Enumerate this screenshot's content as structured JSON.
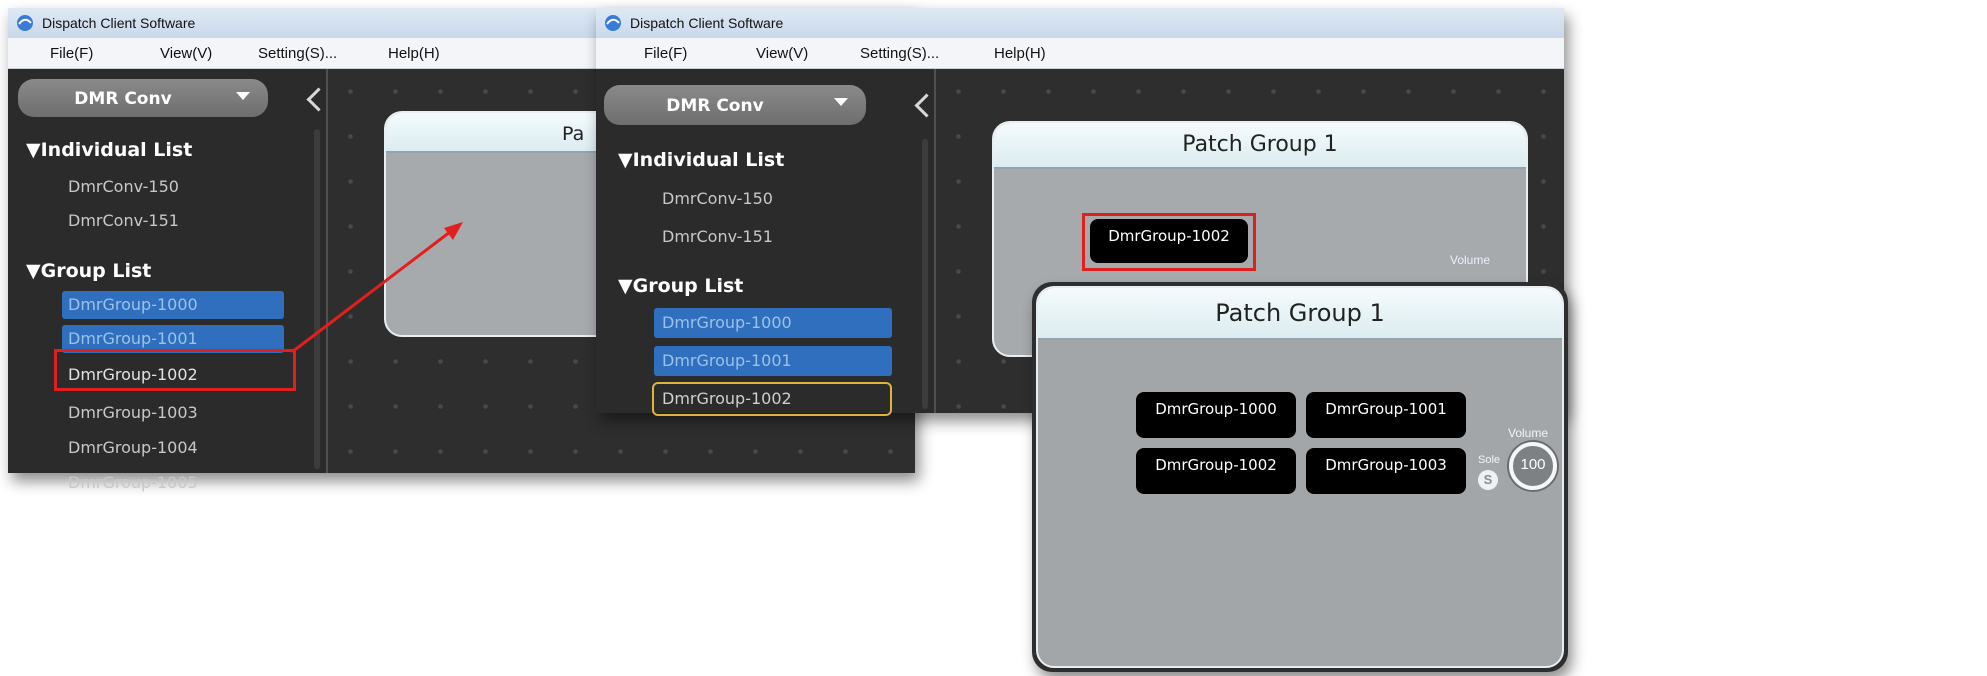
{
  "window1": {
    "title": "Dispatch Client Software",
    "menu": [
      "File(F)",
      "View(V)",
      "Setting(S)...",
      "Help(H)"
    ],
    "combo": "DMR Conv",
    "individual_header": "▼Individual List",
    "individual_items": [
      "DmrConv-150",
      "DmrConv-151"
    ],
    "group_header": "▼Group List",
    "group_items": [
      "DmrGroup-1000",
      "DmrGroup-1001",
      "DmrGroup-1002",
      "DmrGroup-1003",
      "DmrGroup-1004",
      "DmrGroup-1005"
    ],
    "panel_title_fragment": "Pa"
  },
  "window2": {
    "title": "Dispatch Client Software",
    "menu": [
      "File(F)",
      "View(V)",
      "Setting(S)...",
      "Help(H)"
    ],
    "combo": "DMR Conv",
    "individual_header": "▼Individual List",
    "individual_items": [
      "DmrConv-150",
      "DmrConv-151"
    ],
    "group_header": "▼Group List",
    "group_items": [
      "DmrGroup-1000",
      "DmrGroup-1001",
      "DmrGroup-1002"
    ],
    "panel_title": "Patch Group 1",
    "chip": "DmrGroup-1002",
    "volume_label": "Volume"
  },
  "panel3": {
    "title": "Patch Group 1",
    "chips": [
      "DmrGroup-1000",
      "DmrGroup-1001",
      "DmrGroup-1002",
      "DmrGroup-1003"
    ],
    "volume_label": "Volume",
    "sole_label": "Sole",
    "sole_icon": "S",
    "volume_value": "100"
  },
  "colors": {
    "selected_item": "#2f6fbd",
    "highlight_red": "#e0201e",
    "focus_yellow": "#e0b33a",
    "canvas": "#2e2e2e"
  }
}
